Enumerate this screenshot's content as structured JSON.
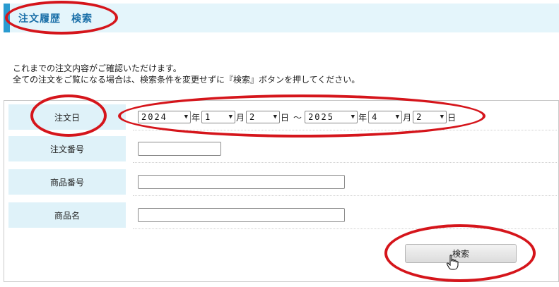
{
  "header": {
    "title": "注文履歴　検索"
  },
  "intro": {
    "line1": "これまでの注文内容がご確認いただけます。",
    "line2": "全ての注文をご覧になる場合は、検索条件を変更せずに『検索』ボタンを押してください。"
  },
  "form": {
    "order_date": {
      "label": "注文日",
      "from": {
        "year": "2024",
        "month": "1",
        "day": "2"
      },
      "to": {
        "year": "2025",
        "month": "4",
        "day": "2"
      },
      "year_unit": "年",
      "month_unit": "月",
      "day_unit": "日",
      "separator": "〜"
    },
    "order_number": {
      "label": "注文番号",
      "value": ""
    },
    "product_number": {
      "label": "商品番号",
      "value": ""
    },
    "product_name": {
      "label": "商品名",
      "value": ""
    },
    "search_button": {
      "label": "検索"
    }
  },
  "annotations": {
    "color": "#d5151b"
  },
  "icons": {
    "dropdown": "chevron-down-icon",
    "cursor": "hand-pointer-icon"
  }
}
